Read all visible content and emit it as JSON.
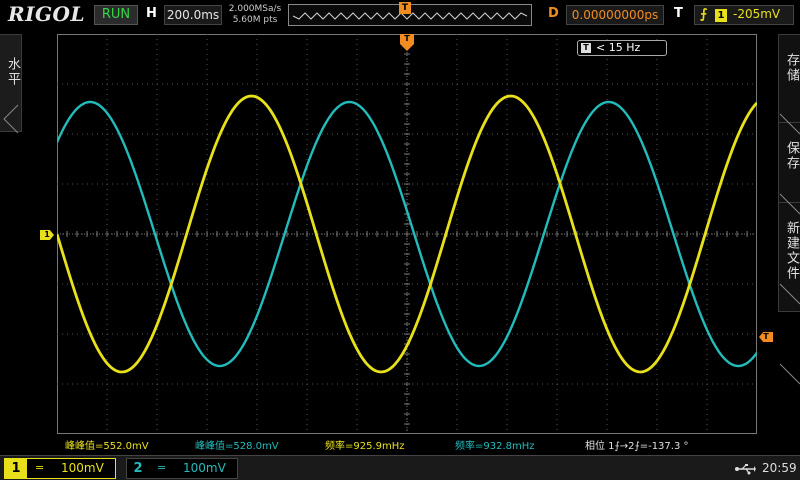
{
  "colors": {
    "ch1": "#e8e01a",
    "ch2": "#22bcbc",
    "trigger": "#f08c20",
    "run": "#35d64a",
    "grid": "#555555"
  },
  "topbar": {
    "logo": "RIGOL",
    "run_status": "RUN",
    "h_label": "H",
    "timebase": "200.0ms",
    "sample_rate": "2.000MSa/s",
    "memory_depth": "5.60M pts",
    "mem_trigger_marker": "T",
    "d_label": "D",
    "delay": "0.00000000ps",
    "t_label": "T",
    "trigger_edge_icon": "rising-edge-icon",
    "trigger_edge_glyph": "⨍",
    "trigger_source": "1",
    "trigger_level": "-205mV"
  },
  "left_tab": {
    "label": "水平"
  },
  "right_tabs": [
    {
      "label": "存储"
    },
    {
      "label": "保存"
    },
    {
      "label": "新建文件"
    }
  ],
  "screen": {
    "trigger_marker": "T",
    "freq_counter": "< 15 Hz",
    "freq_counter_marker": "T",
    "ch1_marker": "1",
    "trigger_level_marker": "T",
    "waveforms": {
      "ch1": {
        "cycles_on_screen": 2.7,
        "phase_at_left_deg": 180,
        "amplitude_fraction": 0.69
      },
      "ch2": {
        "cycles_on_screen": 2.7,
        "phase_at_left_deg": 44,
        "amplitude_fraction": 0.66
      }
    }
  },
  "measurements": [
    {
      "text": "峰峰值=552.0mV",
      "channel": "ch1"
    },
    {
      "text": "峰峰值=528.0mV",
      "channel": "ch2"
    },
    {
      "text": "频率=925.9mHz",
      "channel": "ch1"
    },
    {
      "text": "频率=932.8mHz",
      "channel": "ch2"
    },
    {
      "text": "相位 1⨍→2⨍=-137.3 °",
      "channel": "phase"
    }
  ],
  "bottombar": {
    "ch1": {
      "number": "1",
      "coupling": "=",
      "scale": "100mV"
    },
    "ch2": {
      "number": "2",
      "coupling": "=",
      "scale": "100mV"
    },
    "usb_icon": "usb-icon",
    "usb_glyph": "⭠",
    "time": "20:59"
  }
}
